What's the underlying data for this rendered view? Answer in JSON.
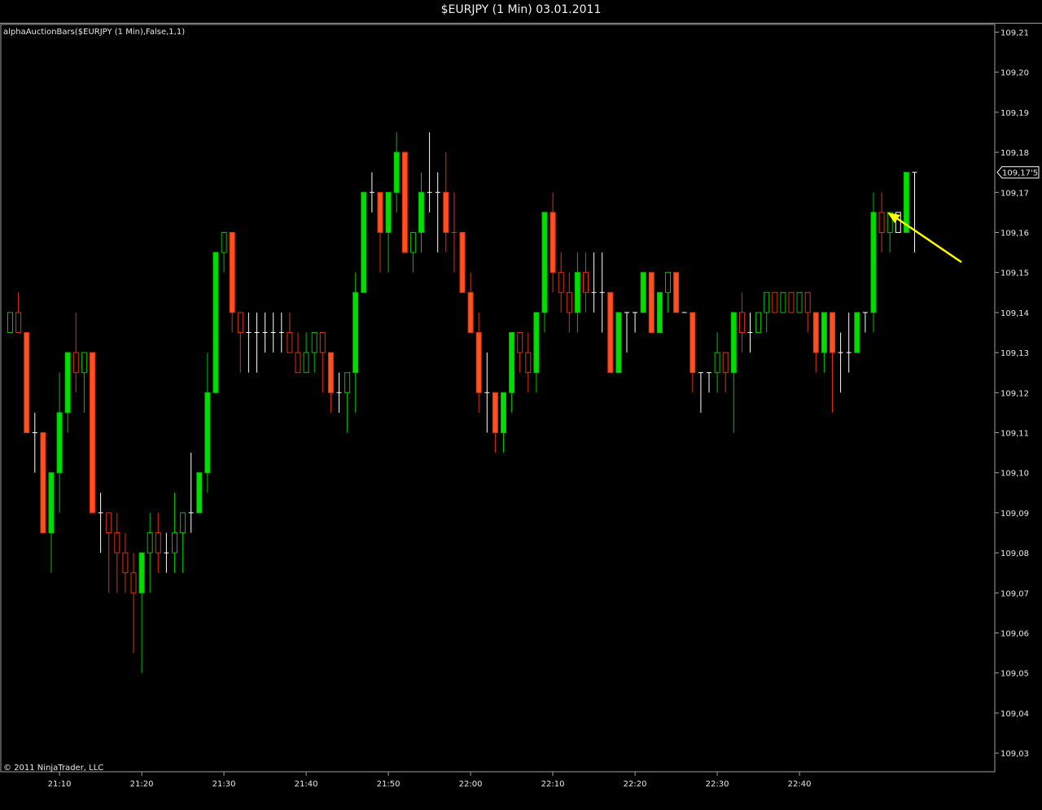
{
  "window": {
    "title": "$EURJPY (1 Min)  03.01.2011"
  },
  "indicator_label": "alphaAuctionBars($EURJPY (1 Min),False,1,1)",
  "copyright": "© 2011 NinjaTrader, LLC",
  "last_price_label": "109,17'5",
  "colors": {
    "background": "#000000",
    "up_outline": "#00c000",
    "up_fill": "#00e000",
    "down_outline": "#e03010",
    "down_fill": "#ff5020",
    "doji": "#ffffff",
    "arrow": "#ffff00",
    "axis": "#a0a0a0"
  },
  "annotation": {
    "type": "arrow",
    "points_to": "last bar",
    "color": "#ffff00"
  },
  "chart_data": {
    "type": "candlestick",
    "title": "$EURJPY (1 Min)  03.01.2011",
    "xlabel": "",
    "ylabel": "",
    "ylim": [
      109.025,
      109.215
    ],
    "y_ticks": [
      "109,21",
      "109,20",
      "109,19",
      "109,18",
      "109,17",
      "109,16",
      "109,15",
      "109,14",
      "109,13",
      "109,12",
      "109,11",
      "109,10",
      "109,09",
      "109,08",
      "109,07",
      "109,06",
      "109,05",
      "109,04",
      "109,03"
    ],
    "y_tick_values": [
      109.21,
      109.2,
      109.19,
      109.18,
      109.17,
      109.16,
      109.15,
      109.14,
      109.13,
      109.12,
      109.11,
      109.1,
      109.09,
      109.08,
      109.07,
      109.06,
      109.05,
      109.04,
      109.03
    ],
    "x_ticks": [
      "21:10",
      "21:20",
      "21:30",
      "21:40",
      "21:50",
      "22:00",
      "22:10",
      "22:20",
      "22:30",
      "22:40"
    ],
    "x_tick_bar_index": [
      6,
      16,
      26,
      36,
      46,
      56,
      66,
      76,
      86,
      96
    ],
    "first_bar_time": "21:04",
    "bars": [
      {
        "o": 109.135,
        "h": 109.14,
        "l": 109.135,
        "c": 109.14,
        "s": "up"
      },
      {
        "o": 109.14,
        "h": 109.145,
        "l": 109.135,
        "c": 109.135,
        "s": "down"
      },
      {
        "o": 109.135,
        "h": 109.135,
        "l": 109.11,
        "c": 109.11,
        "s": "down"
      },
      {
        "o": 109.11,
        "h": 109.115,
        "l": 109.1,
        "c": 109.11,
        "s": "doji"
      },
      {
        "o": 109.11,
        "h": 109.11,
        "l": 109.085,
        "c": 109.085,
        "s": "down"
      },
      {
        "o": 109.085,
        "h": 109.1,
        "l": 109.075,
        "c": 109.1,
        "s": "up"
      },
      {
        "o": 109.1,
        "h": 109.125,
        "l": 109.09,
        "c": 109.115,
        "s": "up"
      },
      {
        "o": 109.115,
        "h": 109.13,
        "l": 109.11,
        "c": 109.13,
        "s": "up"
      },
      {
        "o": 109.13,
        "h": 109.14,
        "l": 109.12,
        "c": 109.125,
        "s": "down"
      },
      {
        "o": 109.125,
        "h": 109.13,
        "l": 109.115,
        "c": 109.13,
        "s": "up"
      },
      {
        "o": 109.13,
        "h": 109.13,
        "l": 109.09,
        "c": 109.09,
        "s": "down"
      },
      {
        "o": 109.09,
        "h": 109.095,
        "l": 109.08,
        "c": 109.09,
        "s": "doji"
      },
      {
        "o": 109.09,
        "h": 109.09,
        "l": 109.07,
        "c": 109.085,
        "s": "down"
      },
      {
        "o": 109.085,
        "h": 109.09,
        "l": 109.07,
        "c": 109.08,
        "s": "down"
      },
      {
        "o": 109.08,
        "h": 109.085,
        "l": 109.07,
        "c": 109.075,
        "s": "down"
      },
      {
        "o": 109.075,
        "h": 109.08,
        "l": 109.055,
        "c": 109.07,
        "s": "down"
      },
      {
        "o": 109.07,
        "h": 109.08,
        "l": 109.05,
        "c": 109.08,
        "s": "up"
      },
      {
        "o": 109.08,
        "h": 109.09,
        "l": 109.07,
        "c": 109.085,
        "s": "up"
      },
      {
        "o": 109.085,
        "h": 109.09,
        "l": 109.075,
        "c": 109.08,
        "s": "down"
      },
      {
        "o": 109.08,
        "h": 109.085,
        "l": 109.075,
        "c": 109.08,
        "s": "doji"
      },
      {
        "o": 109.08,
        "h": 109.095,
        "l": 109.075,
        "c": 109.085,
        "s": "up"
      },
      {
        "o": 109.085,
        "h": 109.09,
        "l": 109.075,
        "c": 109.09,
        "s": "up"
      },
      {
        "o": 109.09,
        "h": 109.105,
        "l": 109.085,
        "c": 109.09,
        "s": "doji"
      },
      {
        "o": 109.09,
        "h": 109.1,
        "l": 109.09,
        "c": 109.1,
        "s": "up"
      },
      {
        "o": 109.1,
        "h": 109.13,
        "l": 109.095,
        "c": 109.12,
        "s": "up"
      },
      {
        "o": 109.12,
        "h": 109.155,
        "l": 109.12,
        "c": 109.155,
        "s": "up"
      },
      {
        "o": 109.155,
        "h": 109.16,
        "l": 109.15,
        "c": 109.16,
        "s": "up"
      },
      {
        "o": 109.16,
        "h": 109.16,
        "l": 109.135,
        "c": 109.14,
        "s": "down"
      },
      {
        "o": 109.14,
        "h": 109.14,
        "l": 109.125,
        "c": 109.135,
        "s": "down"
      },
      {
        "o": 109.135,
        "h": 109.14,
        "l": 109.125,
        "c": 109.135,
        "s": "doji"
      },
      {
        "o": 109.135,
        "h": 109.14,
        "l": 109.125,
        "c": 109.135,
        "s": "doji"
      },
      {
        "o": 109.135,
        "h": 109.14,
        "l": 109.13,
        "c": 109.135,
        "s": "doji"
      },
      {
        "o": 109.135,
        "h": 109.14,
        "l": 109.13,
        "c": 109.135,
        "s": "doji"
      },
      {
        "o": 109.135,
        "h": 109.14,
        "l": 109.13,
        "c": 109.135,
        "s": "doji"
      },
      {
        "o": 109.135,
        "h": 109.14,
        "l": 109.13,
        "c": 109.13,
        "s": "down"
      },
      {
        "o": 109.13,
        "h": 109.135,
        "l": 109.125,
        "c": 109.125,
        "s": "down"
      },
      {
        "o": 109.125,
        "h": 109.135,
        "l": 109.125,
        "c": 109.13,
        "s": "up"
      },
      {
        "o": 109.13,
        "h": 109.135,
        "l": 109.125,
        "c": 109.135,
        "s": "up"
      },
      {
        "o": 109.135,
        "h": 109.135,
        "l": 109.12,
        "c": 109.13,
        "s": "down"
      },
      {
        "o": 109.13,
        "h": 109.13,
        "l": 109.115,
        "c": 109.12,
        "s": "down"
      },
      {
        "o": 109.12,
        "h": 109.125,
        "l": 109.115,
        "c": 109.12,
        "s": "doji"
      },
      {
        "o": 109.12,
        "h": 109.125,
        "l": 109.11,
        "c": 109.125,
        "s": "up"
      },
      {
        "o": 109.125,
        "h": 109.15,
        "l": 109.115,
        "c": 109.145,
        "s": "up"
      },
      {
        "o": 109.145,
        "h": 109.17,
        "l": 109.145,
        "c": 109.17,
        "s": "up"
      },
      {
        "o": 109.17,
        "h": 109.175,
        "l": 109.165,
        "c": 109.17,
        "s": "doji"
      },
      {
        "o": 109.17,
        "h": 109.17,
        "l": 109.15,
        "c": 109.16,
        "s": "down"
      },
      {
        "o": 109.16,
        "h": 109.17,
        "l": 109.15,
        "c": 109.17,
        "s": "up"
      },
      {
        "o": 109.17,
        "h": 109.185,
        "l": 109.165,
        "c": 109.18,
        "s": "up"
      },
      {
        "o": 109.18,
        "h": 109.18,
        "l": 109.155,
        "c": 109.155,
        "s": "down"
      },
      {
        "o": 109.155,
        "h": 109.16,
        "l": 109.15,
        "c": 109.16,
        "s": "up"
      },
      {
        "o": 109.16,
        "h": 109.175,
        "l": 109.155,
        "c": 109.17,
        "s": "up"
      },
      {
        "o": 109.17,
        "h": 109.185,
        "l": 109.165,
        "c": 109.17,
        "s": "doji"
      },
      {
        "o": 109.17,
        "h": 109.175,
        "l": 109.155,
        "c": 109.17,
        "s": "doji"
      },
      {
        "o": 109.17,
        "h": 109.18,
        "l": 109.155,
        "c": 109.16,
        "s": "down"
      },
      {
        "o": 109.16,
        "h": 109.17,
        "l": 109.15,
        "c": 109.16,
        "s": "down"
      },
      {
        "o": 109.16,
        "h": 109.16,
        "l": 109.145,
        "c": 109.145,
        "s": "down"
      },
      {
        "o": 109.145,
        "h": 109.15,
        "l": 109.135,
        "c": 109.135,
        "s": "down"
      },
      {
        "o": 109.135,
        "h": 109.14,
        "l": 109.115,
        "c": 109.12,
        "s": "down"
      },
      {
        "o": 109.12,
        "h": 109.13,
        "l": 109.11,
        "c": 109.12,
        "s": "doji"
      },
      {
        "o": 109.12,
        "h": 109.12,
        "l": 109.105,
        "c": 109.11,
        "s": "down"
      },
      {
        "o": 109.11,
        "h": 109.12,
        "l": 109.105,
        "c": 109.12,
        "s": "up"
      },
      {
        "o": 109.12,
        "h": 109.135,
        "l": 109.115,
        "c": 109.135,
        "s": "up"
      },
      {
        "o": 109.135,
        "h": 109.135,
        "l": 109.125,
        "c": 109.13,
        "s": "down"
      },
      {
        "o": 109.13,
        "h": 109.135,
        "l": 109.12,
        "c": 109.125,
        "s": "down"
      },
      {
        "o": 109.125,
        "h": 109.14,
        "l": 109.12,
        "c": 109.14,
        "s": "up"
      },
      {
        "o": 109.14,
        "h": 109.165,
        "l": 109.135,
        "c": 109.165,
        "s": "up"
      },
      {
        "o": 109.165,
        "h": 109.17,
        "l": 109.145,
        "c": 109.15,
        "s": "down"
      },
      {
        "o": 109.15,
        "h": 109.155,
        "l": 109.14,
        "c": 109.145,
        "s": "down"
      },
      {
        "o": 109.145,
        "h": 109.15,
        "l": 109.135,
        "c": 109.14,
        "s": "down"
      },
      {
        "o": 109.14,
        "h": 109.155,
        "l": 109.135,
        "c": 109.15,
        "s": "up"
      },
      {
        "o": 109.15,
        "h": 109.155,
        "l": 109.14,
        "c": 109.145,
        "s": "down"
      },
      {
        "o": 109.145,
        "h": 109.155,
        "l": 109.14,
        "c": 109.145,
        "s": "doji"
      },
      {
        "o": 109.145,
        "h": 109.155,
        "l": 109.135,
        "c": 109.145,
        "s": "doji"
      },
      {
        "o": 109.145,
        "h": 109.145,
        "l": 109.125,
        "c": 109.125,
        "s": "down"
      },
      {
        "o": 109.125,
        "h": 109.14,
        "l": 109.125,
        "c": 109.14,
        "s": "up"
      },
      {
        "o": 109.14,
        "h": 109.14,
        "l": 109.13,
        "c": 109.14,
        "s": "doji"
      },
      {
        "o": 109.14,
        "h": 109.14,
        "l": 109.135,
        "c": 109.14,
        "s": "doji"
      },
      {
        "o": 109.14,
        "h": 109.15,
        "l": 109.14,
        "c": 109.15,
        "s": "up"
      },
      {
        "o": 109.15,
        "h": 109.15,
        "l": 109.135,
        "c": 109.135,
        "s": "down"
      },
      {
        "o": 109.135,
        "h": 109.145,
        "l": 109.135,
        "c": 109.145,
        "s": "up"
      },
      {
        "o": 109.145,
        "h": 109.15,
        "l": 109.14,
        "c": 109.15,
        "s": "up"
      },
      {
        "o": 109.15,
        "h": 109.15,
        "l": 109.14,
        "c": 109.14,
        "s": "down"
      },
      {
        "o": 109.14,
        "h": 109.14,
        "l": 109.14,
        "c": 109.14,
        "s": "doji"
      },
      {
        "o": 109.14,
        "h": 109.14,
        "l": 109.12,
        "c": 109.125,
        "s": "down"
      },
      {
        "o": 109.125,
        "h": 109.125,
        "l": 109.115,
        "c": 109.125,
        "s": "doji"
      },
      {
        "o": 109.125,
        "h": 109.125,
        "l": 109.12,
        "c": 109.125,
        "s": "doji"
      },
      {
        "o": 109.125,
        "h": 109.135,
        "l": 109.12,
        "c": 109.13,
        "s": "up"
      },
      {
        "o": 109.13,
        "h": 109.13,
        "l": 109.12,
        "c": 109.125,
        "s": "down"
      },
      {
        "o": 109.125,
        "h": 109.14,
        "l": 109.11,
        "c": 109.14,
        "s": "up"
      },
      {
        "o": 109.14,
        "h": 109.145,
        "l": 109.13,
        "c": 109.135,
        "s": "down"
      },
      {
        "o": 109.135,
        "h": 109.14,
        "l": 109.13,
        "c": 109.135,
        "s": "doji"
      },
      {
        "o": 109.135,
        "h": 109.14,
        "l": 109.135,
        "c": 109.14,
        "s": "up"
      },
      {
        "o": 109.14,
        "h": 109.145,
        "l": 109.135,
        "c": 109.145,
        "s": "up"
      },
      {
        "o": 109.145,
        "h": 109.145,
        "l": 109.14,
        "c": 109.14,
        "s": "down"
      },
      {
        "o": 109.14,
        "h": 109.145,
        "l": 109.14,
        "c": 109.145,
        "s": "up"
      },
      {
        "o": 109.145,
        "h": 109.145,
        "l": 109.14,
        "c": 109.14,
        "s": "down"
      },
      {
        "o": 109.14,
        "h": 109.145,
        "l": 109.14,
        "c": 109.145,
        "s": "up"
      },
      {
        "o": 109.145,
        "h": 109.145,
        "l": 109.135,
        "c": 109.14,
        "s": "down"
      },
      {
        "o": 109.14,
        "h": 109.14,
        "l": 109.125,
        "c": 109.13,
        "s": "down"
      },
      {
        "o": 109.13,
        "h": 109.14,
        "l": 109.125,
        "c": 109.14,
        "s": "up"
      },
      {
        "o": 109.14,
        "h": 109.14,
        "l": 109.115,
        "c": 109.13,
        "s": "down"
      },
      {
        "o": 109.13,
        "h": 109.135,
        "l": 109.12,
        "c": 109.13,
        "s": "doji"
      },
      {
        "o": 109.13,
        "h": 109.14,
        "l": 109.125,
        "c": 109.13,
        "s": "doji"
      },
      {
        "o": 109.13,
        "h": 109.14,
        "l": 109.13,
        "c": 109.14,
        "s": "up"
      },
      {
        "o": 109.14,
        "h": 109.14,
        "l": 109.135,
        "c": 109.14,
        "s": "doji"
      },
      {
        "o": 109.14,
        "h": 109.17,
        "l": 109.135,
        "c": 109.165,
        "s": "up"
      },
      {
        "o": 109.165,
        "h": 109.17,
        "l": 109.155,
        "c": 109.16,
        "s": "down"
      },
      {
        "o": 109.16,
        "h": 109.165,
        "l": 109.155,
        "c": 109.165,
        "s": "up"
      },
      {
        "o": 109.165,
        "h": 109.165,
        "l": 109.16,
        "c": 109.16,
        "s": "doji"
      },
      {
        "o": 109.16,
        "h": 109.175,
        "l": 109.16,
        "c": 109.175,
        "s": "up"
      },
      {
        "o": 109.175,
        "h": 109.175,
        "l": 109.155,
        "c": 109.175,
        "s": "doji"
      }
    ],
    "grid": false,
    "legend": "none"
  }
}
